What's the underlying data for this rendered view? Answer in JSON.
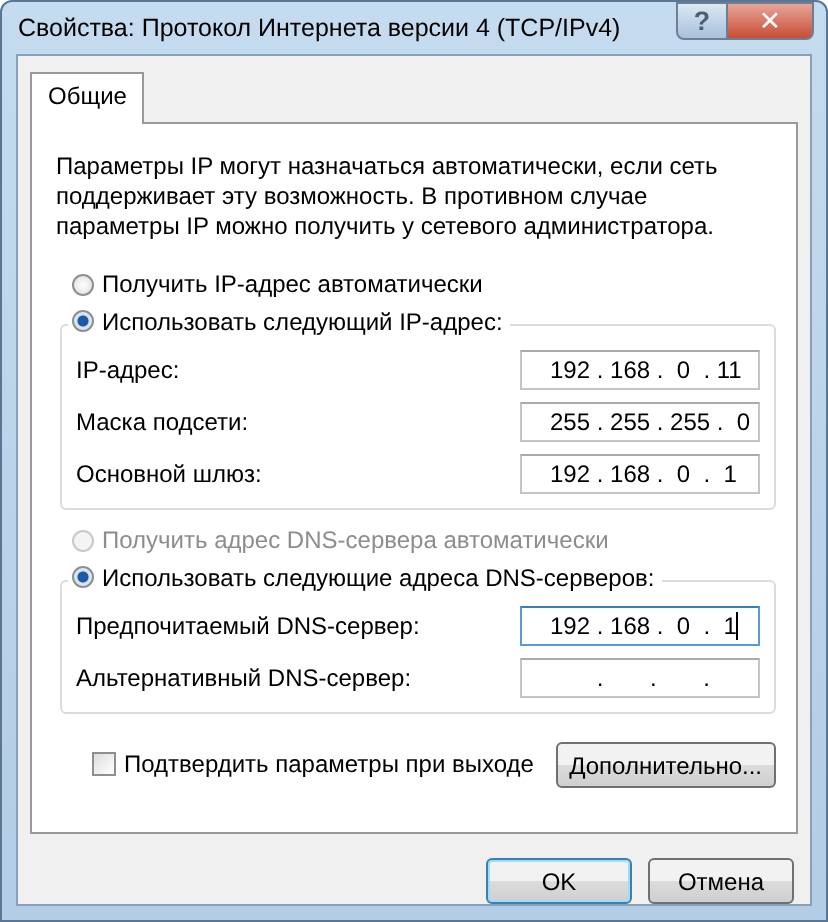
{
  "window": {
    "title": "Свойства: Протокол Интернета версии 4 (TCP/IPv4)",
    "help": "?",
    "close": "✕"
  },
  "tabs": [
    {
      "label": "Общие",
      "selected": true
    }
  ],
  "description": "Параметры IP могут назначаться автоматически, если сеть поддерживает эту возможность. В противном случае параметры IP можно получить у сетевого администратора.",
  "ip_options": [
    {
      "label": "Получить IP-адрес автоматически",
      "selected": false,
      "disabled": false
    },
    {
      "label": "Использовать следующий IP-адрес:",
      "selected": true,
      "disabled": false
    }
  ],
  "ip_fields": [
    {
      "label": "IP-адрес:",
      "value": "192 . 168 .  0  . 11"
    },
    {
      "label": "Маска подсети:",
      "value": "255 . 255 . 255 .  0"
    },
    {
      "label": "Основной шлюз:",
      "value": "192 . 168 .  0  .  1"
    }
  ],
  "dns_options": [
    {
      "label": "Получить адрес DNS-сервера автоматически",
      "selected": false,
      "disabled": true
    },
    {
      "label": "Использовать следующие адреса DNS-серверов:",
      "selected": true,
      "disabled": false
    }
  ],
  "dns_fields": [
    {
      "label": "Предпочитаемый DNS-сервер:",
      "value": "192 . 168 .  0  .  1",
      "focused": true
    },
    {
      "label": "Альтернативный DNS-сервер:",
      "value": "       .       .       .",
      "focused": false
    }
  ],
  "validate": {
    "label": "Подтвердить параметры при выходе",
    "checked": false
  },
  "advanced_button": "Дополнительно...",
  "buttons": [
    {
      "label": "OK",
      "default": true
    },
    {
      "label": "Отмена",
      "default": false
    }
  ]
}
